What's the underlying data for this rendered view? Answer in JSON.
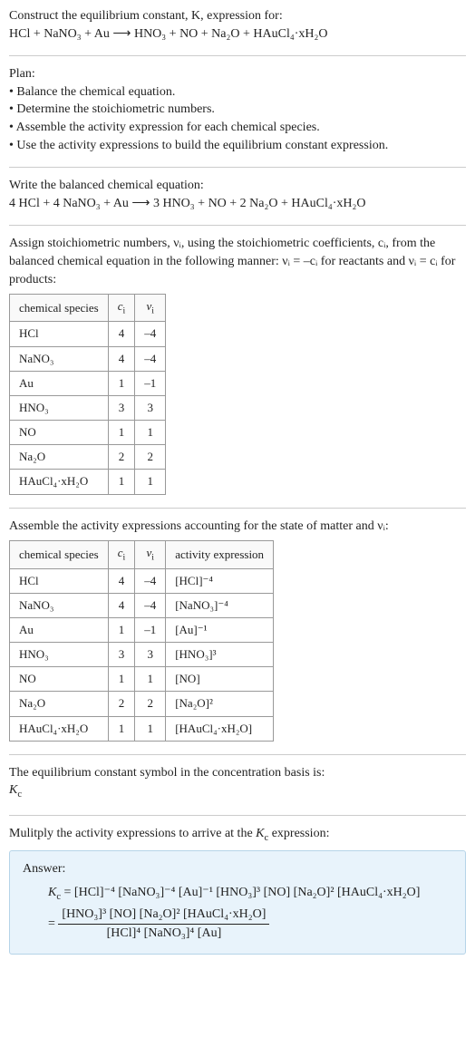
{
  "title_line1": "Construct the equilibrium constant, K, expression for:",
  "title_eq": "HCl + NaNO₃ + Au ⟶ HNO₃ + NO + Na₂O + HAuCl₄·xH₂O",
  "plan_heading": "Plan:",
  "plan_items": [
    "• Balance the chemical equation.",
    "• Determine the stoichiometric numbers.",
    "• Assemble the activity expression for each chemical species.",
    "• Use the activity expressions to build the equilibrium constant expression."
  ],
  "balanced_heading": "Write the balanced chemical equation:",
  "balanced_eq": "4 HCl + 4 NaNO₃ + Au ⟶ 3 HNO₃ + NO + 2 Na₂O + HAuCl₄·xH₂O",
  "assign_text_1": "Assign stoichiometric numbers, νᵢ, using the stoichiometric coefficients, cᵢ, from the balanced chemical equation in the following manner: νᵢ = –cᵢ for reactants and νᵢ = cᵢ for products:",
  "table1": {
    "headers": [
      "chemical species",
      "cᵢ",
      "νᵢ"
    ],
    "rows": [
      [
        "HCl",
        "4",
        "–4"
      ],
      [
        "NaNO₃",
        "4",
        "–4"
      ],
      [
        "Au",
        "1",
        "–1"
      ],
      [
        "HNO₃",
        "3",
        "3"
      ],
      [
        "NO",
        "1",
        "1"
      ],
      [
        "Na₂O",
        "2",
        "2"
      ],
      [
        "HAuCl₄·xH₂O",
        "1",
        "1"
      ]
    ]
  },
  "assemble_text": "Assemble the activity expressions accounting for the state of matter and νᵢ:",
  "table2": {
    "headers": [
      "chemical species",
      "cᵢ",
      "νᵢ",
      "activity expression"
    ],
    "rows": [
      [
        "HCl",
        "4",
        "–4",
        "[HCl]⁻⁴"
      ],
      [
        "NaNO₃",
        "4",
        "–4",
        "[NaNO₃]⁻⁴"
      ],
      [
        "Au",
        "1",
        "–1",
        "[Au]⁻¹"
      ],
      [
        "HNO₃",
        "3",
        "3",
        "[HNO₃]³"
      ],
      [
        "NO",
        "1",
        "1",
        "[NO]"
      ],
      [
        "Na₂O",
        "2",
        "2",
        "[Na₂O]²"
      ],
      [
        "HAuCl₄·xH₂O",
        "1",
        "1",
        "[HAuCl₄·xH₂O]"
      ]
    ]
  },
  "symbol_text": "The equilibrium constant symbol in the concentration basis is:",
  "symbol_value": "K_c",
  "multiply_text": "Mulitply the activity expressions to arrive at the K_c expression:",
  "answer_label": "Answer:",
  "answer_line1": "K_c = [HCl]⁻⁴ [NaNO₃]⁻⁴ [Au]⁻¹ [HNO₃]³ [NO] [Na₂O]² [HAuCl₄·xH₂O]",
  "answer_frac_num": "[HNO₃]³ [NO] [Na₂O]² [HAuCl₄·xH₂O]",
  "answer_frac_den": "[HCl]⁴ [NaNO₃]⁴ [Au]"
}
